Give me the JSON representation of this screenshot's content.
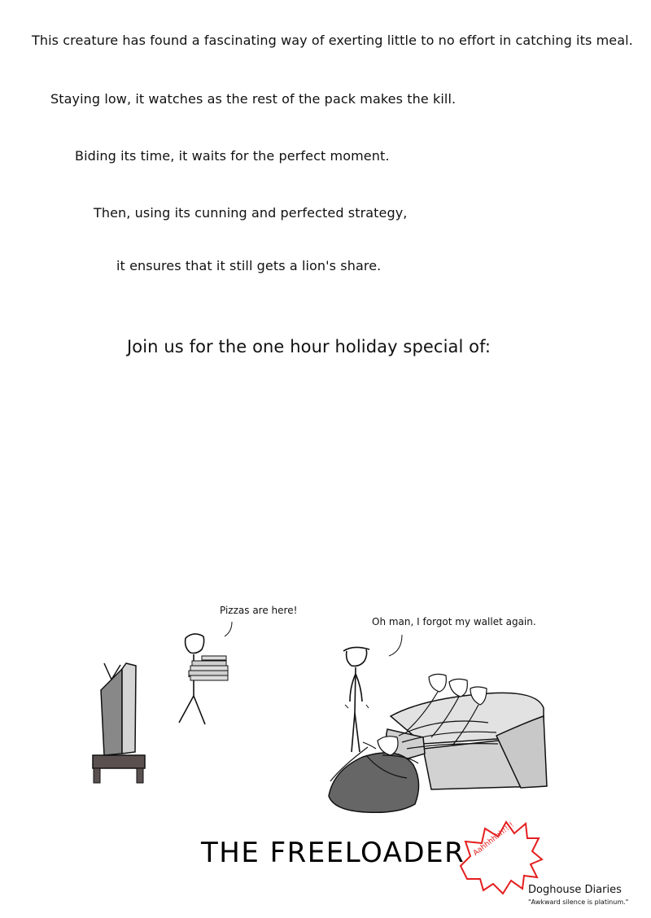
{
  "narration": [
    "This creature has found a fascinating way of exerting little to no effort in catching its meal.",
    "Staying low, it watches as the rest of the pack makes the kill.",
    "Biding its time, it waits for the perfect moment.",
    "Then, using its cunning and perfected strategy,",
    "it ensures that it still gets a lion's share."
  ],
  "invite": "Join us for the one hour holiday special of:",
  "speech": {
    "pizza_guy": "Pizzas are here!",
    "freeloader": "Oh man, I forgot my wallet again."
  },
  "title": "THE FREELOADER",
  "burst_text": "Aahhhhhh!!!!",
  "signature": "Doghouse Diaries",
  "tagline": "\"Awkward silence is platinum.\"",
  "colors": {
    "burst": "#e41f1f",
    "tv_dark": "#888888",
    "tv_light": "#d4d4d4",
    "stand": "#5a5050",
    "beanbag": "#666666",
    "couch": "#d8d8d8"
  }
}
